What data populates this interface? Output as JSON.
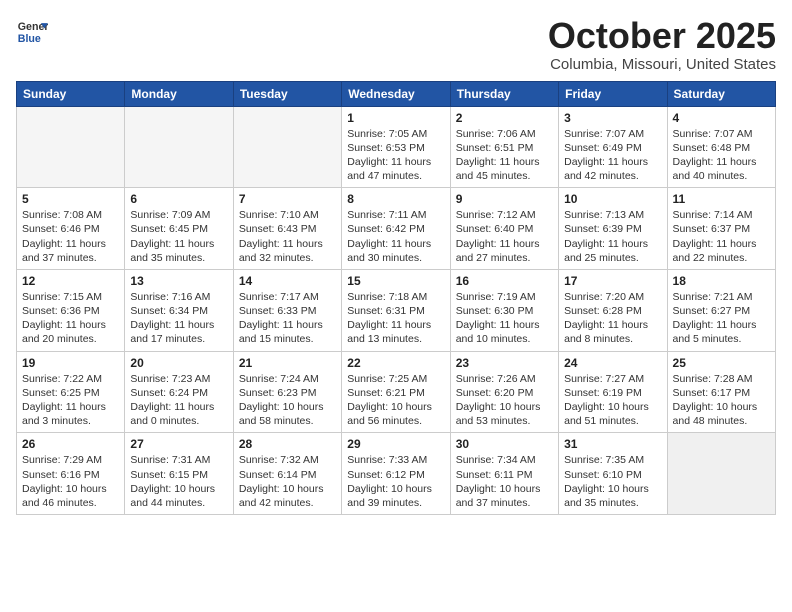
{
  "header": {
    "logo_line1": "General",
    "logo_line2": "Blue",
    "title": "October 2025",
    "subtitle": "Columbia, Missouri, United States"
  },
  "weekdays": [
    "Sunday",
    "Monday",
    "Tuesday",
    "Wednesday",
    "Thursday",
    "Friday",
    "Saturday"
  ],
  "weeks": [
    [
      {
        "day": "",
        "info": "",
        "empty": true
      },
      {
        "day": "",
        "info": "",
        "empty": true
      },
      {
        "day": "",
        "info": "",
        "empty": true
      },
      {
        "day": "1",
        "info": "Sunrise: 7:05 AM\nSunset: 6:53 PM\nDaylight: 11 hours\nand 47 minutes."
      },
      {
        "day": "2",
        "info": "Sunrise: 7:06 AM\nSunset: 6:51 PM\nDaylight: 11 hours\nand 45 minutes."
      },
      {
        "day": "3",
        "info": "Sunrise: 7:07 AM\nSunset: 6:49 PM\nDaylight: 11 hours\nand 42 minutes."
      },
      {
        "day": "4",
        "info": "Sunrise: 7:07 AM\nSunset: 6:48 PM\nDaylight: 11 hours\nand 40 minutes."
      }
    ],
    [
      {
        "day": "5",
        "info": "Sunrise: 7:08 AM\nSunset: 6:46 PM\nDaylight: 11 hours\nand 37 minutes."
      },
      {
        "day": "6",
        "info": "Sunrise: 7:09 AM\nSunset: 6:45 PM\nDaylight: 11 hours\nand 35 minutes."
      },
      {
        "day": "7",
        "info": "Sunrise: 7:10 AM\nSunset: 6:43 PM\nDaylight: 11 hours\nand 32 minutes."
      },
      {
        "day": "8",
        "info": "Sunrise: 7:11 AM\nSunset: 6:42 PM\nDaylight: 11 hours\nand 30 minutes."
      },
      {
        "day": "9",
        "info": "Sunrise: 7:12 AM\nSunset: 6:40 PM\nDaylight: 11 hours\nand 27 minutes."
      },
      {
        "day": "10",
        "info": "Sunrise: 7:13 AM\nSunset: 6:39 PM\nDaylight: 11 hours\nand 25 minutes."
      },
      {
        "day": "11",
        "info": "Sunrise: 7:14 AM\nSunset: 6:37 PM\nDaylight: 11 hours\nand 22 minutes."
      }
    ],
    [
      {
        "day": "12",
        "info": "Sunrise: 7:15 AM\nSunset: 6:36 PM\nDaylight: 11 hours\nand 20 minutes."
      },
      {
        "day": "13",
        "info": "Sunrise: 7:16 AM\nSunset: 6:34 PM\nDaylight: 11 hours\nand 17 minutes."
      },
      {
        "day": "14",
        "info": "Sunrise: 7:17 AM\nSunset: 6:33 PM\nDaylight: 11 hours\nand 15 minutes."
      },
      {
        "day": "15",
        "info": "Sunrise: 7:18 AM\nSunset: 6:31 PM\nDaylight: 11 hours\nand 13 minutes."
      },
      {
        "day": "16",
        "info": "Sunrise: 7:19 AM\nSunset: 6:30 PM\nDaylight: 11 hours\nand 10 minutes."
      },
      {
        "day": "17",
        "info": "Sunrise: 7:20 AM\nSunset: 6:28 PM\nDaylight: 11 hours\nand 8 minutes."
      },
      {
        "day": "18",
        "info": "Sunrise: 7:21 AM\nSunset: 6:27 PM\nDaylight: 11 hours\nand 5 minutes."
      }
    ],
    [
      {
        "day": "19",
        "info": "Sunrise: 7:22 AM\nSunset: 6:25 PM\nDaylight: 11 hours\nand 3 minutes."
      },
      {
        "day": "20",
        "info": "Sunrise: 7:23 AM\nSunset: 6:24 PM\nDaylight: 11 hours\nand 0 minutes."
      },
      {
        "day": "21",
        "info": "Sunrise: 7:24 AM\nSunset: 6:23 PM\nDaylight: 10 hours\nand 58 minutes."
      },
      {
        "day": "22",
        "info": "Sunrise: 7:25 AM\nSunset: 6:21 PM\nDaylight: 10 hours\nand 56 minutes."
      },
      {
        "day": "23",
        "info": "Sunrise: 7:26 AM\nSunset: 6:20 PM\nDaylight: 10 hours\nand 53 minutes."
      },
      {
        "day": "24",
        "info": "Sunrise: 7:27 AM\nSunset: 6:19 PM\nDaylight: 10 hours\nand 51 minutes."
      },
      {
        "day": "25",
        "info": "Sunrise: 7:28 AM\nSunset: 6:17 PM\nDaylight: 10 hours\nand 48 minutes."
      }
    ],
    [
      {
        "day": "26",
        "info": "Sunrise: 7:29 AM\nSunset: 6:16 PM\nDaylight: 10 hours\nand 46 minutes."
      },
      {
        "day": "27",
        "info": "Sunrise: 7:31 AM\nSunset: 6:15 PM\nDaylight: 10 hours\nand 44 minutes."
      },
      {
        "day": "28",
        "info": "Sunrise: 7:32 AM\nSunset: 6:14 PM\nDaylight: 10 hours\nand 42 minutes."
      },
      {
        "day": "29",
        "info": "Sunrise: 7:33 AM\nSunset: 6:12 PM\nDaylight: 10 hours\nand 39 minutes."
      },
      {
        "day": "30",
        "info": "Sunrise: 7:34 AM\nSunset: 6:11 PM\nDaylight: 10 hours\nand 37 minutes."
      },
      {
        "day": "31",
        "info": "Sunrise: 7:35 AM\nSunset: 6:10 PM\nDaylight: 10 hours\nand 35 minutes."
      },
      {
        "day": "",
        "info": "",
        "empty": true
      }
    ]
  ]
}
